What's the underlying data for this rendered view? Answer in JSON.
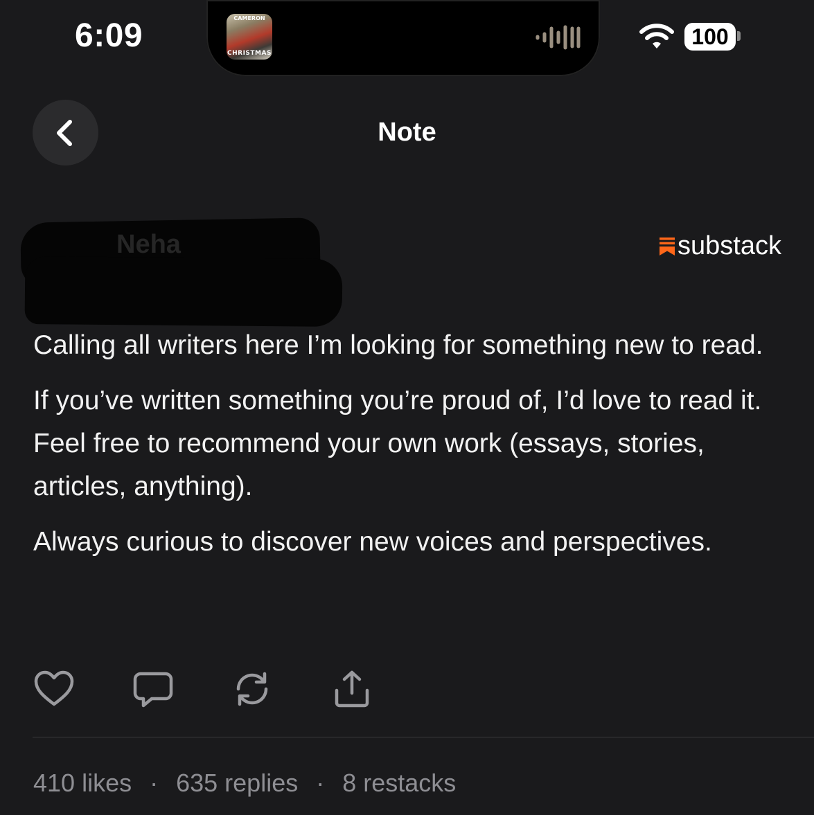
{
  "status_bar": {
    "time": "6:09",
    "battery": "100",
    "now_playing_art_top": "CAMERON",
    "now_playing_art_caption": "CHRISTMAS"
  },
  "header": {
    "title": "Note",
    "back_icon": "chevron-left-icon"
  },
  "author": {
    "name": "Neha",
    "publication_brand": "substack",
    "brand_color": "#ff6719"
  },
  "note": {
    "paragraphs": [
      "Calling all writers here  I’m looking for something new to read.",
      "If you’ve written something you’re proud of, I’d love to read it. Feel free to recommend your own work (essays, stories, articles, anything).",
      "Always curious to discover new voices and perspectives."
    ]
  },
  "actions": [
    {
      "icon": "heart-icon"
    },
    {
      "icon": "comment-icon"
    },
    {
      "icon": "restack-icon"
    },
    {
      "icon": "share-icon"
    }
  ],
  "stats": {
    "likes": "410 likes",
    "replies": "635 replies",
    "restacks": "8 restacks",
    "separator": "·"
  }
}
